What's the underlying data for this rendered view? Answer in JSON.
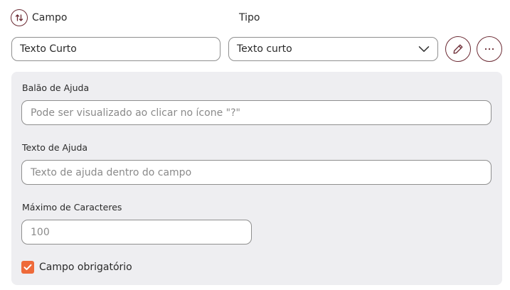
{
  "header": {
    "campo_label": "Campo",
    "tipo_label": "Tipo"
  },
  "field": {
    "name_value": "Texto Curto",
    "type_selected": "Texto curto"
  },
  "help_balloon": {
    "label": "Balão de Ajuda",
    "placeholder": "Pode ser visualizado ao clicar no ícone \"?\""
  },
  "help_text": {
    "label": "Texto de Ajuda",
    "placeholder": "Texto de ajuda dentro do campo"
  },
  "max_chars": {
    "label": "Máximo de Caracteres",
    "placeholder": "100"
  },
  "required": {
    "label": "Campo obrigatório",
    "checked": true
  },
  "colors": {
    "accent": "#6b2a33",
    "checkbox": "#ee6a3a",
    "panel_bg": "#eeeef1"
  },
  "icons": {
    "sort": "sort-arrows-icon",
    "edit": "pencil-icon",
    "more": "ellipsis-icon",
    "dropdown": "chevron-down-icon",
    "check": "check-icon"
  }
}
